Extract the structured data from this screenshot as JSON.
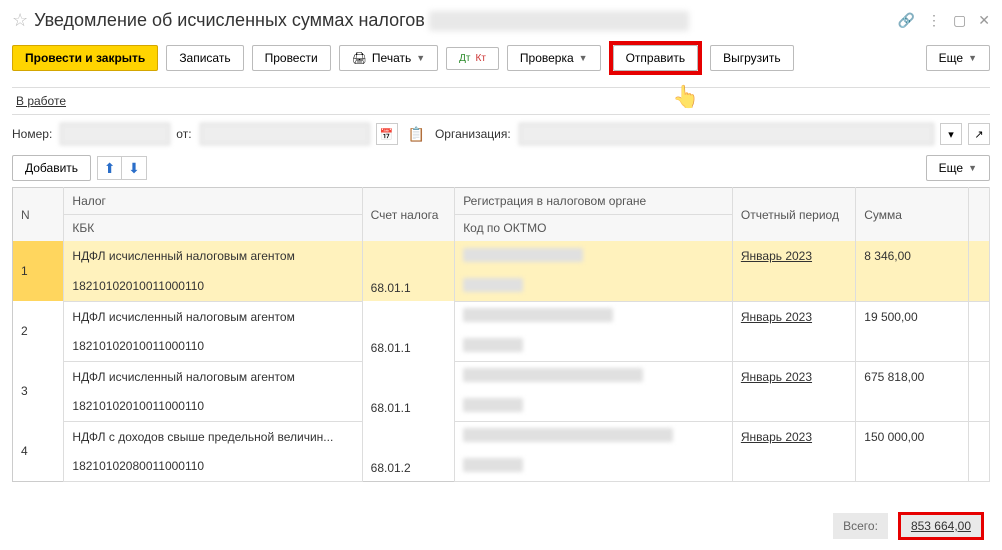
{
  "title": "Уведомление об исчисленных суммах налогов",
  "toolbar": {
    "submit_close": "Провести и закрыть",
    "save": "Записать",
    "submit": "Провести",
    "print": "Печать",
    "check": "Проверка",
    "send": "Отправить",
    "export": "Выгрузить",
    "more": "Еще"
  },
  "status": {
    "in_work": "В работе"
  },
  "form": {
    "number_label": "Номер:",
    "from_label": "от:",
    "org_label": "Организация:"
  },
  "actions": {
    "add": "Добавить",
    "more": "Еще"
  },
  "headers": {
    "n": "N",
    "tax": "Налог",
    "kbk": "КБК",
    "account": "Счет налога",
    "registration": "Регистрация в налоговом органе",
    "oktmo": "Код по ОКТМО",
    "period": "Отчетный период",
    "sum": "Сумма"
  },
  "rows": [
    {
      "n": "1",
      "tax": "НДФЛ исчисленный налоговым агентом",
      "kbk": "18210102010011000110",
      "account": "68.01.1",
      "period": "Январь 2023",
      "sum": "8 346,00"
    },
    {
      "n": "2",
      "tax": "НДФЛ исчисленный налоговым агентом",
      "kbk": "18210102010011000110",
      "account": "68.01.1",
      "period": "Январь 2023",
      "sum": "19 500,00"
    },
    {
      "n": "3",
      "tax": "НДФЛ исчисленный налоговым агентом",
      "kbk": "18210102010011000110",
      "account": "68.01.1",
      "period": "Январь 2023",
      "sum": "675 818,00"
    },
    {
      "n": "4",
      "tax": "НДФЛ с доходов свыше предельной величин...",
      "kbk": "18210102080011000110",
      "account": "68.01.2",
      "period": "Январь 2023",
      "sum": "150 000,00"
    }
  ],
  "footer": {
    "total_label": "Всего:",
    "total_value": "853 664,00"
  }
}
